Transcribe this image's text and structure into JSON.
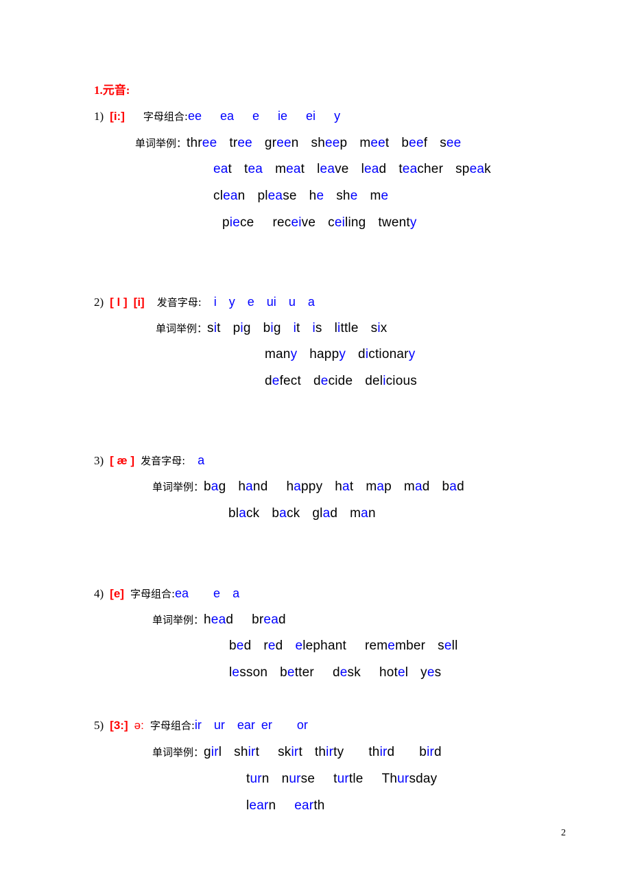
{
  "document": {
    "title": "1.元音:",
    "page_number": "2",
    "colors": {
      "accent_red": "#ff0000",
      "highlight_blue": "#0000ff",
      "text_black": "#000000",
      "background": "#ffffff"
    },
    "labels": {
      "letter_combination": "字母组合:",
      "pronounced_letters": "发音字母:",
      "word_examples": "单词举例："
    }
  },
  "sections": [
    {
      "index": "1)",
      "phonetic": "[i:]",
      "phonetic_secondary": "",
      "combo_label": "字母组合:",
      "combos": [
        "ee",
        "ea",
        "e",
        "ie",
        "ei",
        "y"
      ],
      "examples_label": "单词举例：",
      "rows": [
        [
          {
            "pre": "thr",
            "hl": "ee",
            "post": ""
          },
          {
            "pre": "tr",
            "hl": "ee",
            "post": ""
          },
          {
            "pre": "gr",
            "hl": "ee",
            "post": "n"
          },
          {
            "pre": "sh",
            "hl": "ee",
            "post": "p"
          },
          {
            "pre": "m",
            "hl": "ee",
            "post": "t"
          },
          {
            "pre": "b",
            "hl": "ee",
            "post": "f"
          },
          {
            "pre": "s",
            "hl": "ee",
            "post": ""
          }
        ],
        [
          {
            "pre": "",
            "hl": "ea",
            "post": "t"
          },
          {
            "pre": "t",
            "hl": "ea",
            "post": ""
          },
          {
            "pre": "m",
            "hl": "ea",
            "post": "t"
          },
          {
            "pre": "l",
            "hl": "ea",
            "post": "ve"
          },
          {
            "pre": "l",
            "hl": "ea",
            "post": "d"
          },
          {
            "pre": "t",
            "hl": "ea",
            "post": "cher"
          },
          {
            "pre": "sp",
            "hl": "ea",
            "post": "k"
          }
        ],
        [
          {
            "pre": "cl",
            "hl": "ea",
            "post": "n"
          },
          {
            "pre": "pl",
            "hl": "ea",
            "post": "se"
          },
          {
            "pre": "h",
            "hl": "e",
            "post": ""
          },
          {
            "pre": "sh",
            "hl": "e",
            "post": ""
          },
          {
            "pre": "m",
            "hl": "e",
            "post": ""
          }
        ],
        [
          {
            "pre": "p",
            "hl": "ie",
            "post": "ce"
          },
          {
            "pre": "rec",
            "hl": "ei",
            "post": "ve"
          },
          {
            "pre": "c",
            "hl": "ei",
            "post": "ling"
          },
          {
            "pre": "twent",
            "hl": "y",
            "post": ""
          }
        ]
      ]
    },
    {
      "index": "2)",
      "phonetic": "[ l ]",
      "phonetic_secondary": "[i]",
      "combo_label": "发音字母:",
      "combos": [
        "i",
        "y",
        "e",
        "ui",
        "u",
        "a"
      ],
      "examples_label": "单词举例：",
      "rows": [
        [
          {
            "pre": "s",
            "hl": "i",
            "post": "t"
          },
          {
            "pre": "p",
            "hl": "i",
            "post": "g"
          },
          {
            "pre": "b",
            "hl": "i",
            "post": "g"
          },
          {
            "pre": "",
            "hl": "i",
            "post": "t"
          },
          {
            "pre": "",
            "hl": "i",
            "post": "s"
          },
          {
            "pre": "l",
            "hl": "i",
            "post": "ttle"
          },
          {
            "pre": "s",
            "hl": "i",
            "post": "x"
          }
        ],
        [
          {
            "pre": "man",
            "hl": "y",
            "post": ""
          },
          {
            "pre": "happ",
            "hl": "y",
            "post": ""
          },
          {
            "pre": "d",
            "hl": "i",
            "post": "ctionar",
            "hl2": "y"
          }
        ],
        [
          {
            "pre": "d",
            "hl": "e",
            "post": "fect"
          },
          {
            "pre": "d",
            "hl": "e",
            "post": "cide"
          },
          {
            "pre": "del",
            "hl": "i",
            "post": "cious"
          }
        ]
      ]
    },
    {
      "index": "3)",
      "phonetic": "[ æ ]",
      "phonetic_secondary": "",
      "combo_label": "发音字母:",
      "combos": [
        "a"
      ],
      "examples_label": "单词举例：",
      "rows": [
        [
          {
            "pre": "b",
            "hl": "a",
            "post": "g"
          },
          {
            "pre": "h",
            "hl": "a",
            "post": "nd"
          },
          {
            "pre": "h",
            "hl": "a",
            "post": "ppy"
          },
          {
            "pre": "h",
            "hl": "a",
            "post": "t"
          },
          {
            "pre": "m",
            "hl": "a",
            "post": "p"
          },
          {
            "pre": "m",
            "hl": "a",
            "post": "d"
          },
          {
            "pre": "b",
            "hl": "a",
            "post": "d"
          }
        ],
        [
          {
            "pre": "bl",
            "hl": "a",
            "post": "ck"
          },
          {
            "pre": "b",
            "hl": "a",
            "post": "ck"
          },
          {
            "pre": "gl",
            "hl": "a",
            "post": "d"
          },
          {
            "pre": "m",
            "hl": "a",
            "post": "n"
          }
        ]
      ]
    },
    {
      "index": "4)",
      "phonetic": "[e]",
      "phonetic_secondary": "",
      "combo_label": "字母组合:",
      "combos": [
        "ea",
        "e",
        "a"
      ],
      "examples_label": "单词举例：",
      "rows": [
        [
          {
            "pre": "h",
            "hl": "ea",
            "post": "d"
          },
          {
            "pre": "br",
            "hl": "ea",
            "post": "d"
          }
        ],
        [
          {
            "pre": "b",
            "hl": "e",
            "post": "d"
          },
          {
            "pre": "r",
            "hl": "e",
            "post": "d"
          },
          {
            "pre": "",
            "hl": "e",
            "post": "lephant"
          },
          {
            "pre": "rem",
            "hl": "e",
            "post": "mber"
          },
          {
            "pre": "s",
            "hl": "e",
            "post": "ll"
          }
        ],
        [
          {
            "pre": "l",
            "hl": "e",
            "post": "sson"
          },
          {
            "pre": "b",
            "hl": "e",
            "post": "tter"
          },
          {
            "pre": "d",
            "hl": "e",
            "post": "sk"
          },
          {
            "pre": "hot",
            "hl": "e",
            "post": "l"
          },
          {
            "pre": "y",
            "hl": "e",
            "post": "s"
          }
        ]
      ]
    },
    {
      "index": "5)",
      "phonetic": "[3:]",
      "phonetic_secondary": "ə:",
      "combo_label": "字母组合:",
      "combos": [
        "ir",
        "ur",
        "ear",
        "er",
        "or"
      ],
      "examples_label": "单词举例：",
      "rows": [
        [
          {
            "pre": "g",
            "hl": "ir",
            "post": "l"
          },
          {
            "pre": "sh",
            "hl": "ir",
            "post": "t"
          },
          {
            "pre": "sk",
            "hl": "ir",
            "post": "t"
          },
          {
            "pre": "th",
            "hl": "ir",
            "post": "ty"
          },
          {
            "pre": "th",
            "hl": "ir",
            "post": "d"
          },
          {
            "pre": "b",
            "hl": "ir",
            "post": "d"
          }
        ],
        [
          {
            "pre": "t",
            "hl": "ur",
            "post": "n"
          },
          {
            "pre": "n",
            "hl": "ur",
            "post": "se"
          },
          {
            "pre": "t",
            "hl": "ur",
            "post": "tle"
          },
          {
            "pre": "Th",
            "hl": "ur",
            "post": "sday"
          }
        ],
        [
          {
            "pre": "l",
            "hl": "ear",
            "post": "n"
          },
          {
            "pre": "",
            "hl": "ear",
            "post": "th"
          }
        ]
      ]
    }
  ]
}
